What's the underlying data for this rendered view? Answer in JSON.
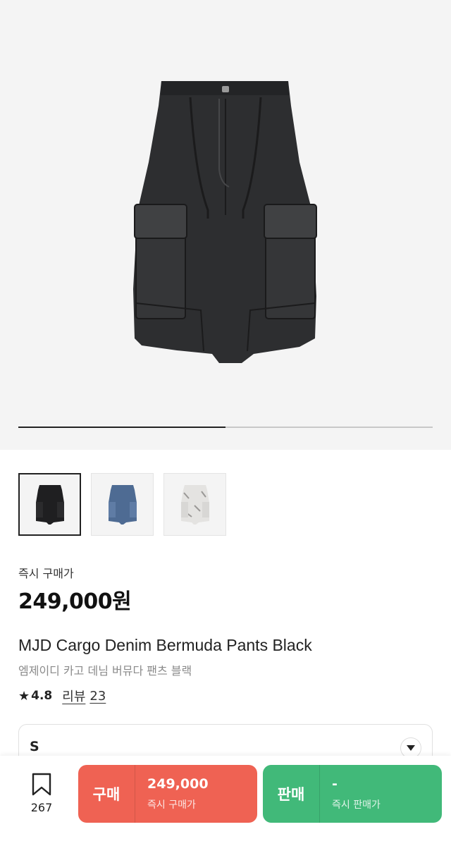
{
  "hero": {
    "progress": 0.5
  },
  "thumbnails": [
    {
      "color": "black",
      "selected": true
    },
    {
      "color": "blue",
      "selected": false
    },
    {
      "color": "white",
      "selected": false
    }
  ],
  "product": {
    "price_label": "즉시 구매가",
    "price": "249,000원",
    "title_en": "MJD Cargo Denim Bermuda Pants Black",
    "title_ko": "엠제이디 카고 데님 버뮤다 팬츠 블랙",
    "rating_star": "★",
    "rating": "4.8",
    "review_label": "리뷰",
    "review_count": "23"
  },
  "size_select": {
    "value": "S"
  },
  "bottom_bar": {
    "wish_count": "267",
    "buy": {
      "label": "구매",
      "price": "249,000",
      "sub": "즉시 구매가",
      "color": "#ef6253"
    },
    "sell": {
      "label": "판매",
      "price": "-",
      "sub": "즉시 판매가",
      "color": "#41b979"
    }
  }
}
